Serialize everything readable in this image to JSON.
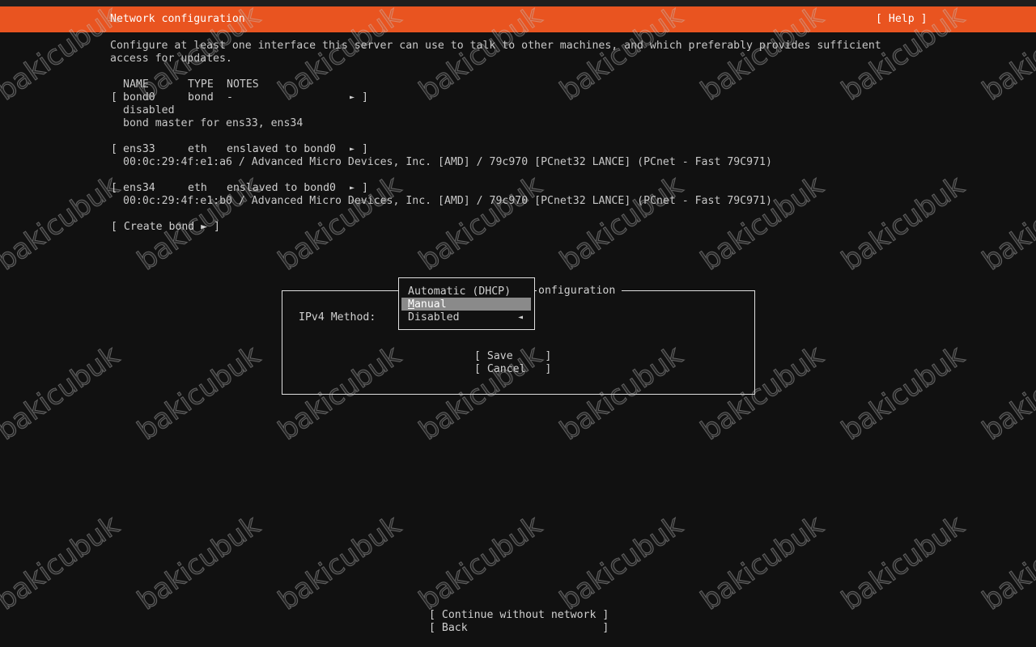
{
  "header": {
    "title": "Network configuration",
    "help": "[ Help ]"
  },
  "intro": {
    "line1": "Configure at least one interface this server can use to talk to other machines, and which preferably provides sufficient",
    "line2": "access for updates."
  },
  "table": {
    "col_name": "NAME",
    "col_type": "TYPE",
    "col_notes": "NOTES"
  },
  "interfaces": [
    {
      "open": "[",
      "name": "bond0",
      "type": "bond",
      "notes": "-",
      "arrow": "►",
      "close": "]",
      "details": [
        "disabled",
        "bond master for ens33, ens34"
      ]
    },
    {
      "open": "[",
      "name": "ens33",
      "type": "eth",
      "notes": "enslaved to bond0",
      "arrow": "►",
      "close": "]",
      "details": [
        "00:0c:29:4f:e1:a6 / Advanced Micro Devices, Inc. [AMD] / 79c970 [PCnet32 LANCE] (PCnet - Fast 79C971)"
      ]
    },
    {
      "open": "[",
      "name": "ens34",
      "type": "eth",
      "notes": "enslaved to bond0",
      "arrow": "►",
      "close": "]",
      "details": [
        "00:0c:29:4f:e1:b0 / Advanced Micro Devices, Inc. [AMD] / 79c970 [PCnet32 LANCE] (PCnet - Fast 79C971)"
      ]
    }
  ],
  "create_bond": "[ Create bond ► ]",
  "dialog": {
    "title_fragment": "onfiguration",
    "ipv4_label": "IPv4 Method:",
    "save": "[ Save     ]",
    "cancel": "[ Cancel   ]"
  },
  "dropdown": {
    "options": [
      "Automatic (DHCP)",
      "anual",
      "Disabled"
    ],
    "manual_initial": "M",
    "selected_index": 1,
    "arrow": "◄"
  },
  "footer": {
    "continue": "[ Continue without network ]",
    "back": "[ Back                     ]"
  },
  "watermark": "bakicubuk"
}
